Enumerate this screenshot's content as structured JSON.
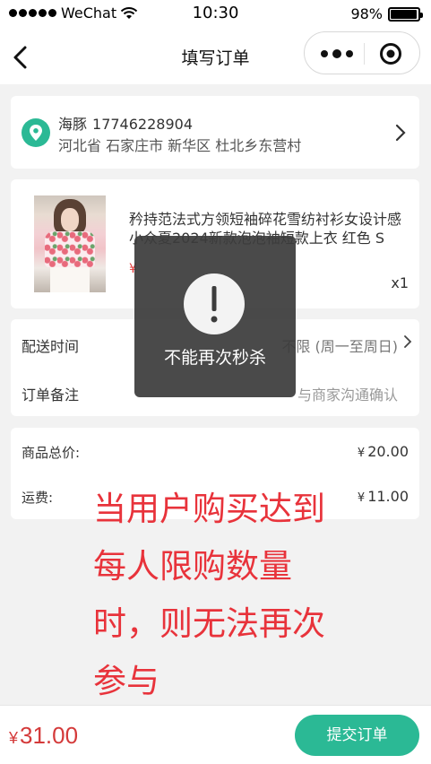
{
  "status_bar": {
    "carrier": "WeChat",
    "time": "10:30",
    "battery": "98%",
    "battery_level": 0.98
  },
  "nav": {
    "title": "填写订单"
  },
  "address": {
    "name": "海豚",
    "phone": "17746228904",
    "detail": "河北省 石家庄市 新华区 杜北乡东营村"
  },
  "product": {
    "title": "矜持范法式方领短袖碎花雪纺衬衫女设计感小众夏2024新款泡泡袖短款上衣 红色 S",
    "price_visible": "¥",
    "quantity": "x1"
  },
  "options": {
    "delivery_label": "配送时间",
    "delivery_value": "不限 (周一至周日)",
    "remark_label": "订单备注",
    "remark_placeholder": "与商家沟通确认"
  },
  "totals": {
    "goods_label": "商品总价:",
    "goods_value": "20.00",
    "freight_label": "运费:",
    "freight_value": "11.00",
    "currency": "¥"
  },
  "annotation": {
    "lines": [
      "当用户购买达到",
      "每人限购数量",
      "时，则无法再次",
      "参与"
    ]
  },
  "bottom": {
    "currency": "¥",
    "total": "31.00",
    "submit_label": "提交订单"
  },
  "toast": {
    "message": "不能再次秒杀"
  },
  "colors": {
    "accent": "#2bb995",
    "price": "#d43a3a",
    "annotation": "#e8333b"
  }
}
